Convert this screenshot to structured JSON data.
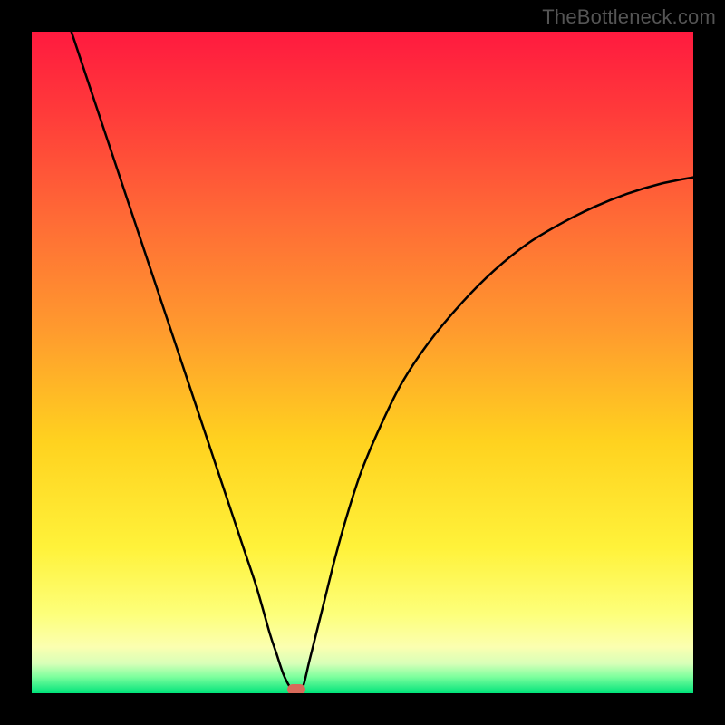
{
  "watermark": "TheBottleneck.com",
  "chart_data": {
    "type": "line",
    "title": "",
    "xlabel": "",
    "ylabel": "",
    "xlim": [
      0,
      100
    ],
    "ylim": [
      0,
      100
    ],
    "grid": false,
    "background_gradient_stops": [
      {
        "pos": 0.0,
        "color": "#ff1a3f"
      },
      {
        "pos": 0.12,
        "color": "#ff3a3a"
      },
      {
        "pos": 0.28,
        "color": "#ff6a36"
      },
      {
        "pos": 0.45,
        "color": "#ff9a2e"
      },
      {
        "pos": 0.62,
        "color": "#ffd21f"
      },
      {
        "pos": 0.78,
        "color": "#fff23a"
      },
      {
        "pos": 0.88,
        "color": "#fdff7a"
      },
      {
        "pos": 0.93,
        "color": "#fbffb0"
      },
      {
        "pos": 0.955,
        "color": "#d8ffb8"
      },
      {
        "pos": 0.975,
        "color": "#7eff9e"
      },
      {
        "pos": 1.0,
        "color": "#00e37a"
      }
    ],
    "series": [
      {
        "name": "bottleneck-curve",
        "color": "#000000",
        "x": [
          6,
          8,
          10,
          12,
          14,
          16,
          18,
          20,
          22,
          24,
          26,
          28,
          30,
          32,
          34,
          36,
          37,
          38,
          39,
          40,
          41,
          42,
          44,
          46,
          48,
          50,
          53,
          56,
          60,
          65,
          70,
          75,
          80,
          85,
          90,
          95,
          100
        ],
        "y": [
          100,
          94,
          88,
          82,
          76,
          70,
          64,
          58,
          52,
          46,
          40,
          34,
          28,
          22,
          16,
          9,
          6,
          3,
          1,
          0,
          1,
          5,
          13,
          21,
          28,
          34,
          41,
          47,
          53,
          59,
          64,
          68,
          71,
          73.5,
          75.5,
          77,
          78
        ]
      }
    ],
    "markers": [
      {
        "name": "optimal-point",
        "x": 40,
        "y": 0.5,
        "color": "#d86a5a"
      }
    ]
  }
}
